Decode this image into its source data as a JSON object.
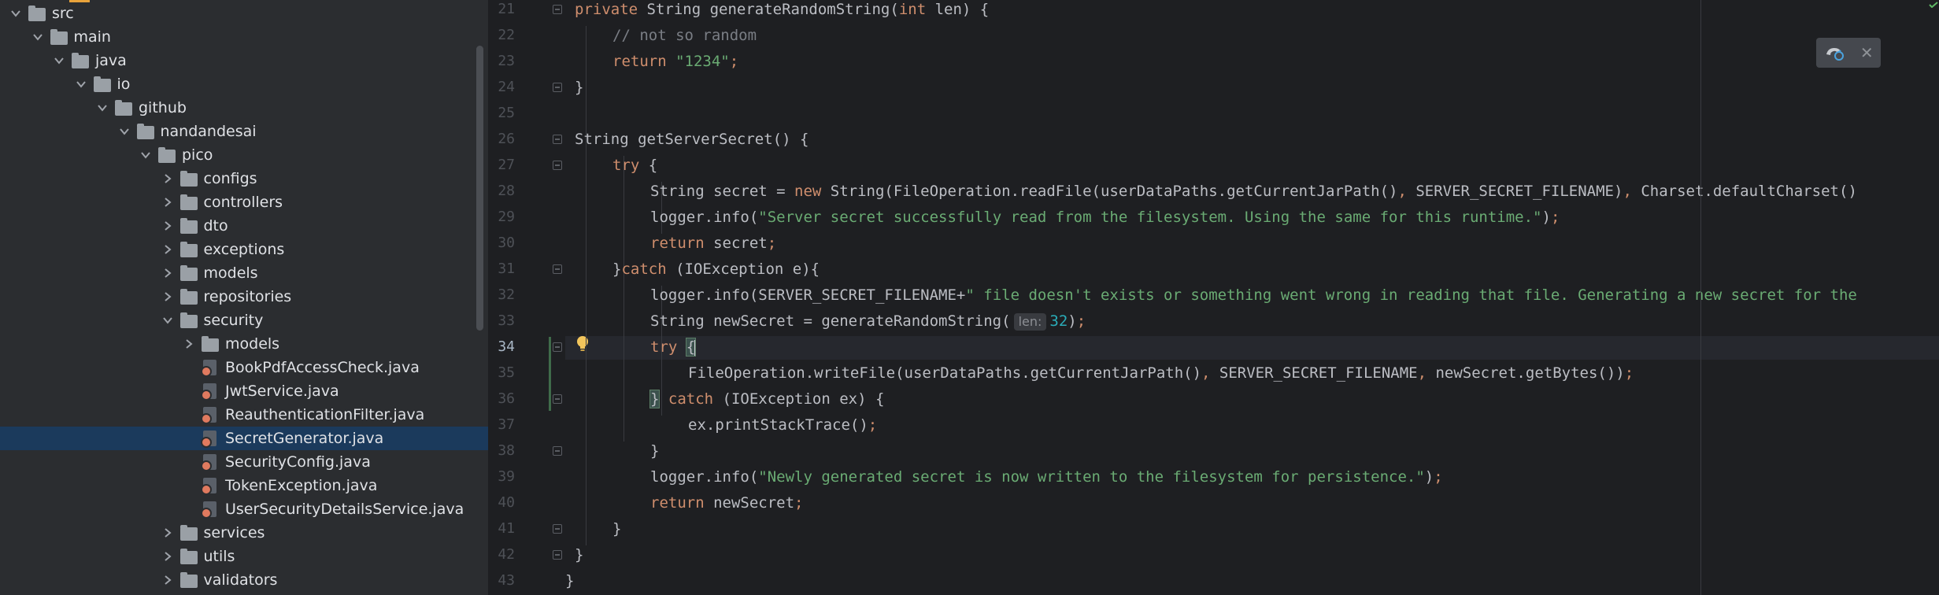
{
  "project_tree": {
    "items": [
      {
        "label": "src",
        "kind": "folder",
        "expanded": true,
        "depth": 0
      },
      {
        "label": "main",
        "kind": "folder",
        "expanded": true,
        "depth": 1
      },
      {
        "label": "java",
        "kind": "folder",
        "expanded": true,
        "depth": 2
      },
      {
        "label": "io",
        "kind": "folder",
        "expanded": true,
        "depth": 3
      },
      {
        "label": "github",
        "kind": "folder",
        "expanded": true,
        "depth": 4
      },
      {
        "label": "nandandesai",
        "kind": "folder",
        "expanded": true,
        "depth": 5
      },
      {
        "label": "pico",
        "kind": "folder",
        "expanded": true,
        "depth": 6
      },
      {
        "label": "configs",
        "kind": "folder",
        "expanded": false,
        "depth": 7
      },
      {
        "label": "controllers",
        "kind": "folder",
        "expanded": false,
        "depth": 7
      },
      {
        "label": "dto",
        "kind": "folder",
        "expanded": false,
        "depth": 7
      },
      {
        "label": "exceptions",
        "kind": "folder",
        "expanded": false,
        "depth": 7
      },
      {
        "label": "models",
        "kind": "folder",
        "expanded": false,
        "depth": 7
      },
      {
        "label": "repositories",
        "kind": "folder",
        "expanded": false,
        "depth": 7
      },
      {
        "label": "security",
        "kind": "folder",
        "expanded": true,
        "depth": 7
      },
      {
        "label": "models",
        "kind": "folder",
        "expanded": false,
        "depth": 8
      },
      {
        "label": "BookPdfAccessCheck.java",
        "kind": "java",
        "depth": 8
      },
      {
        "label": "JwtService.java",
        "kind": "java",
        "depth": 8
      },
      {
        "label": "ReauthenticationFilter.java",
        "kind": "java",
        "depth": 8
      },
      {
        "label": "SecretGenerator.java",
        "kind": "java",
        "depth": 8,
        "selected": true
      },
      {
        "label": "SecurityConfig.java",
        "kind": "java",
        "depth": 8
      },
      {
        "label": "TokenException.java",
        "kind": "java",
        "depth": 8
      },
      {
        "label": "UserSecurityDetailsService.java",
        "kind": "java",
        "depth": 8
      },
      {
        "label": "services",
        "kind": "folder",
        "expanded": false,
        "depth": 7
      },
      {
        "label": "utils",
        "kind": "folder",
        "expanded": false,
        "depth": 7
      },
      {
        "label": "validators",
        "kind": "folder",
        "expanded": false,
        "depth": 7
      }
    ]
  },
  "editor": {
    "current_line": 34,
    "lines": [
      {
        "num": 21,
        "indent": 1,
        "fold": true,
        "tokens": [
          {
            "t": "kw",
            "v": "private "
          },
          {
            "t": "p",
            "v": "String generateRandomString("
          },
          {
            "t": "kw",
            "v": "int "
          },
          {
            "t": "p",
            "v": "len) {"
          }
        ]
      },
      {
        "num": 22,
        "indent": 2,
        "tokens": [
          {
            "t": "cmt",
            "v": "// not so random"
          }
        ]
      },
      {
        "num": 23,
        "indent": 2,
        "tokens": [
          {
            "t": "kw",
            "v": "return "
          },
          {
            "t": "str",
            "v": "\"1234\""
          },
          {
            "t": "kw",
            "v": ";"
          }
        ]
      },
      {
        "num": 24,
        "indent": 1,
        "fold": true,
        "tokens": [
          {
            "t": "p",
            "v": "}"
          }
        ]
      },
      {
        "num": 25,
        "indent": 0,
        "tokens": []
      },
      {
        "num": 26,
        "indent": 1,
        "fold": true,
        "tokens": [
          {
            "t": "p",
            "v": "String getServerSecret() {"
          }
        ]
      },
      {
        "num": 27,
        "indent": 2,
        "fold": true,
        "tokens": [
          {
            "t": "kw",
            "v": "try "
          },
          {
            "t": "p",
            "v": "{"
          }
        ]
      },
      {
        "num": 28,
        "indent": 3,
        "tokens": [
          {
            "t": "p",
            "v": "String secret = "
          },
          {
            "t": "kw",
            "v": "new "
          },
          {
            "t": "p",
            "v": "String(FileOperation.readFile(userDataPaths.getCurrentJarPath()"
          },
          {
            "t": "kw",
            "v": ", "
          },
          {
            "t": "p",
            "v": "SERVER_SECRET_FILENAME)"
          },
          {
            "t": "kw",
            "v": ", "
          },
          {
            "t": "p",
            "v": "Charset.defaultCharset()"
          }
        ]
      },
      {
        "num": 29,
        "indent": 3,
        "tokens": [
          {
            "t": "p",
            "v": "logger.info("
          },
          {
            "t": "str",
            "v": "\"Server secret successfully read from the filesystem. Using the same for this runtime.\""
          },
          {
            "t": "p",
            "v": ")"
          },
          {
            "t": "kw",
            "v": ";"
          }
        ]
      },
      {
        "num": 30,
        "indent": 3,
        "tokens": [
          {
            "t": "kw",
            "v": "return "
          },
          {
            "t": "p",
            "v": "secret"
          },
          {
            "t": "kw",
            "v": ";"
          }
        ]
      },
      {
        "num": 31,
        "indent": 2,
        "fold": true,
        "tokens": [
          {
            "t": "p",
            "v": "}"
          },
          {
            "t": "kw",
            "v": "catch "
          },
          {
            "t": "p",
            "v": "(IOException e){"
          }
        ]
      },
      {
        "num": 32,
        "indent": 3,
        "tokens": [
          {
            "t": "p",
            "v": "logger.info(SERVER_SECRET_FILENAME+"
          },
          {
            "t": "str",
            "v": "\" file doesn't exists or something went wrong in reading that file. Generating a new secret for the"
          }
        ]
      },
      {
        "num": 33,
        "indent": 3,
        "tokens": [
          {
            "t": "p",
            "v": "String newSecret = generateRandomString("
          },
          {
            "t": "hint",
            "v": "len:"
          },
          {
            "t": "num",
            "v": "32"
          },
          {
            "t": "p",
            "v": ")"
          },
          {
            "t": "kw",
            "v": ";"
          }
        ]
      },
      {
        "num": 34,
        "indent": 3,
        "fold": true,
        "tokens": [
          {
            "t": "kw",
            "v": "try "
          },
          {
            "t": "br",
            "v": "{"
          },
          {
            "t": "caret",
            "v": ""
          }
        ]
      },
      {
        "num": 35,
        "indent": 4,
        "tokens": [
          {
            "t": "p",
            "v": "FileOperation.writeFile(userDataPaths.getCurrentJarPath()"
          },
          {
            "t": "kw",
            "v": ", "
          },
          {
            "t": "p",
            "v": "SERVER_SECRET_FILENAME"
          },
          {
            "t": "kw",
            "v": ", "
          },
          {
            "t": "p",
            "v": "newSecret.getBytes())"
          },
          {
            "t": "kw",
            "v": ";"
          }
        ]
      },
      {
        "num": 36,
        "indent": 3,
        "fold": true,
        "tokens": [
          {
            "t": "br",
            "v": "}"
          },
          {
            "t": "kw",
            "v": " catch "
          },
          {
            "t": "p",
            "v": "(IOException ex) {"
          }
        ]
      },
      {
        "num": 37,
        "indent": 4,
        "tokens": [
          {
            "t": "p",
            "v": "ex.printStackTrace()"
          },
          {
            "t": "kw",
            "v": ";"
          }
        ]
      },
      {
        "num": 38,
        "indent": 3,
        "fold": true,
        "tokens": [
          {
            "t": "p",
            "v": "}"
          }
        ]
      },
      {
        "num": 39,
        "indent": 3,
        "tokens": [
          {
            "t": "p",
            "v": "logger.info("
          },
          {
            "t": "str",
            "v": "\"Newly generated secret is now written to the filesystem for persistence.\""
          },
          {
            "t": "p",
            "v": ")"
          },
          {
            "t": "kw",
            "v": ";"
          }
        ]
      },
      {
        "num": 40,
        "indent": 3,
        "tokens": [
          {
            "t": "kw",
            "v": "return "
          },
          {
            "t": "p",
            "v": "newSecret"
          },
          {
            "t": "kw",
            "v": ";"
          }
        ]
      },
      {
        "num": 41,
        "indent": 2,
        "fold": true,
        "tokens": [
          {
            "t": "p",
            "v": "}"
          }
        ]
      },
      {
        "num": 42,
        "indent": 1,
        "fold": true,
        "tokens": [
          {
            "t": "p",
            "v": "}"
          }
        ]
      },
      {
        "num": 43,
        "indent": 0,
        "tokens": [
          {
            "t": "p",
            "v": "}"
          }
        ]
      }
    ]
  },
  "plugin_popup": {
    "icon": "plugin-status-icon",
    "close_icon": "close-icon"
  },
  "colors": {
    "tree_bg": "#2b2d30",
    "editor_bg": "#1e1f22",
    "selection": "#1b3a5c",
    "keyword": "#cf8e6d",
    "string": "#6aab73",
    "comment": "#7a7e85",
    "number": "#2aacb8",
    "text": "#bcbec4"
  }
}
